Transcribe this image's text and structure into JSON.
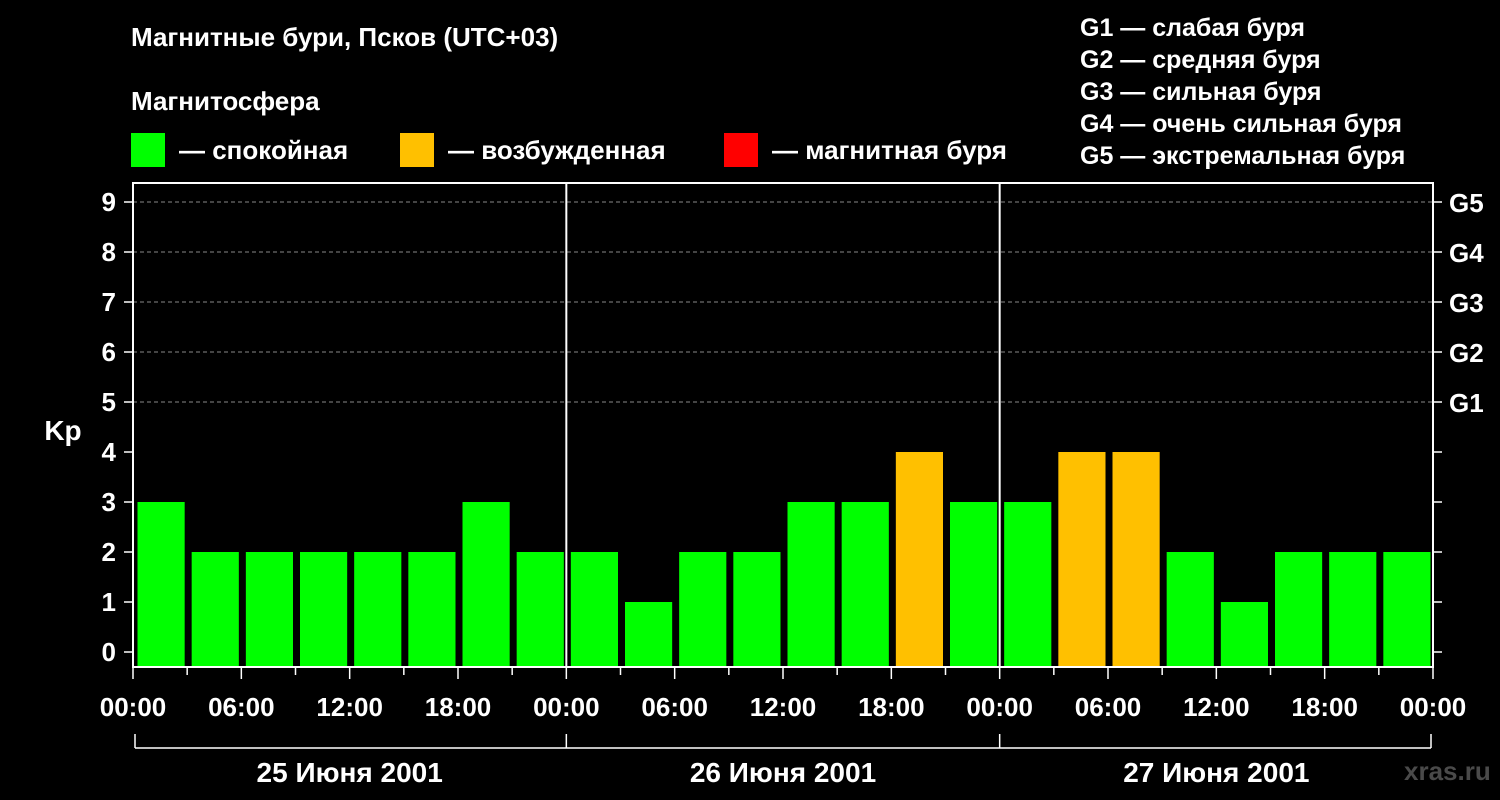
{
  "title": "Магнитные бури, Псков (UTC+03)",
  "subtitle": "Магнитосфера",
  "legend": [
    {
      "label": "— спокойная",
      "color": "#00ff00"
    },
    {
      "label": "— возбужденная",
      "color": "#ffc000"
    },
    {
      "label": "— магнитная буря",
      "color": "#ff0000"
    }
  ],
  "g_levels": [
    "G1 — слабая буря",
    "G2 — средняя буря",
    "G3 — сильная буря",
    "G4 — очень сильная буря",
    "G5 — экстремальная буря"
  ],
  "watermark": "xras.ru",
  "chart_data": {
    "type": "bar",
    "ylabel": "Kp",
    "xlabel": "",
    "ylim": [
      0,
      9
    ],
    "y_ticks": [
      "0",
      "1",
      "2",
      "3",
      "4",
      "5",
      "6",
      "7",
      "8",
      "9"
    ],
    "right_ticks": [
      {
        "kp": 5,
        "label": "G1"
      },
      {
        "kp": 6,
        "label": "G2"
      },
      {
        "kp": 7,
        "label": "G3"
      },
      {
        "kp": 8,
        "label": "G4"
      },
      {
        "kp": 9,
        "label": "G5"
      }
    ],
    "grid": "dashed horizontal at Kp 5-9",
    "x_ticks": [
      "00:00",
      "06:00",
      "12:00",
      "18:00",
      "00:00",
      "06:00",
      "12:00",
      "18:00",
      "00:00",
      "06:00",
      "12:00",
      "18:00",
      "00:00"
    ],
    "days": [
      "25 Июня 2001",
      "26 Июня 2001",
      "27 Июня 2001"
    ],
    "bar_hours": 3,
    "values": [
      3,
      2,
      2,
      2,
      2,
      2,
      3,
      2,
      2,
      1,
      2,
      2,
      3,
      3,
      4,
      3,
      3,
      4,
      4,
      2,
      1,
      2,
      2,
      2
    ],
    "colors": {
      "quiet": "#00ff00",
      "disturbed": "#ffc000",
      "storm": "#ff0000"
    }
  }
}
